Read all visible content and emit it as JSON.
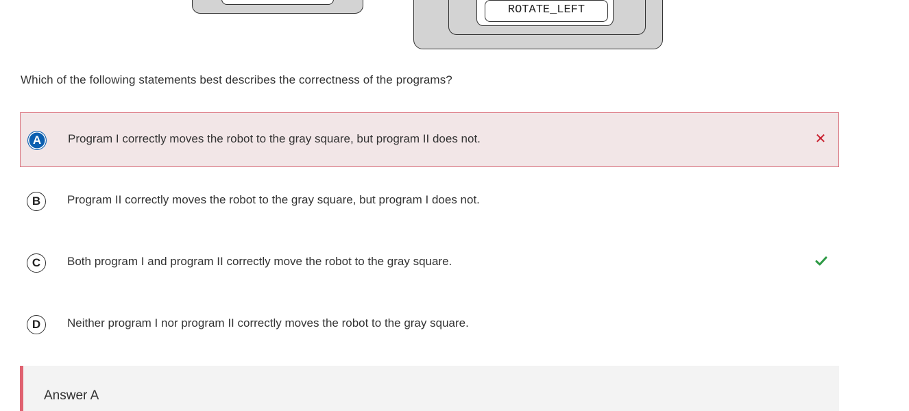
{
  "code_block": {
    "command": "ROTATE_LEFT"
  },
  "question": "Which of the following statements best describes the correctness of the programs?",
  "options": [
    {
      "letter": "A",
      "text": "Program I correctly moves the robot to the gray square, but program II does not.",
      "state": "selected-incorrect",
      "mark_icon": "x-icon"
    },
    {
      "letter": "B",
      "text": "Program II correctly moves the robot to the gray square, but program I does not.",
      "state": "unselected",
      "mark_icon": ""
    },
    {
      "letter": "C",
      "text": "Both program I and program II correctly move the robot to the gray square.",
      "state": "correct",
      "mark_icon": "check-icon"
    },
    {
      "letter": "D",
      "text": "Neither program I nor program II correctly moves the robot to the gray square.",
      "state": "unselected",
      "mark_icon": ""
    }
  ],
  "answer": {
    "label": "Answer A"
  },
  "colors": {
    "selected_bg": "#f2e6e7",
    "selected_border": "#d9707c",
    "selected_letter_bg": "#0b5fb0",
    "wrong_mark": "#c8202f",
    "correct_mark": "#2e9a45",
    "answer_accent": "#e06270"
  }
}
